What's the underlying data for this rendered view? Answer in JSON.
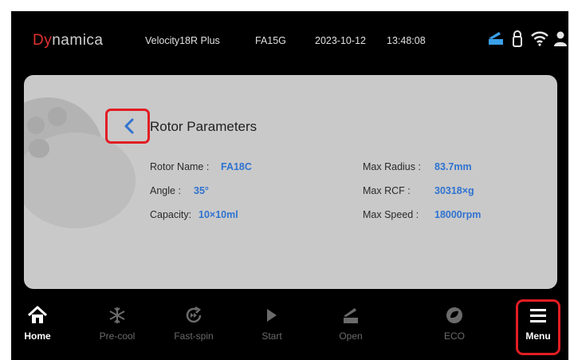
{
  "status_bar": {
    "brand_prefix": "Dy",
    "brand_suffix": "namica",
    "model": "Velocity18R Plus",
    "rotor_code": "FA15G",
    "date": "2023-10-12",
    "time": "13:48:08",
    "icons": [
      "lid-open-icon",
      "lock-icon",
      "wifi-icon",
      "user-icon"
    ],
    "accent_color": "#3aa0e8"
  },
  "panel": {
    "title": "Rotor Parameters",
    "back_icon": "chevron-left-icon",
    "left": [
      {
        "label": "Rotor Name :",
        "value": "FA18C"
      },
      {
        "label": "Angle :",
        "value": "35°"
      },
      {
        "label": "Capacity:",
        "value": "10×10ml"
      }
    ],
    "right": [
      {
        "label": "Max Radius :",
        "value": "83.7mm"
      },
      {
        "label": "Max RCF :",
        "value": "30318×g"
      },
      {
        "label": "Max Speed :",
        "value": "18000rpm"
      }
    ],
    "value_color": "#2f73d0"
  },
  "nav": {
    "items": [
      {
        "label": "Home",
        "icon": "home-icon",
        "active": true
      },
      {
        "label": "Pre-cool",
        "icon": "snowflake-icon",
        "active": false
      },
      {
        "label": "Fast-spin",
        "icon": "fast-spin-icon",
        "active": false
      },
      {
        "label": "Start",
        "icon": "play-icon",
        "active": false
      },
      {
        "label": "Open",
        "icon": "lid-open-icon",
        "active": false
      },
      {
        "label": "ECO",
        "icon": "eco-icon",
        "active": false
      },
      {
        "label": "Menu",
        "icon": "menu-icon",
        "active": true
      }
    ],
    "highlight_color": "#e21d23"
  }
}
